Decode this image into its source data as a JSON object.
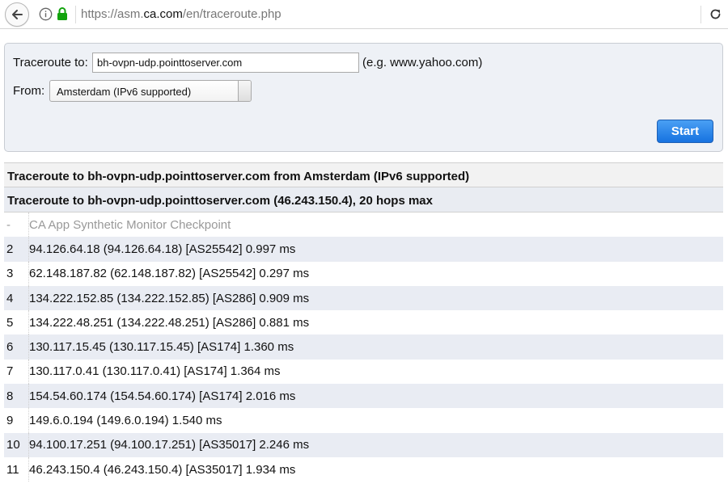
{
  "browser": {
    "url_prefix": "https://asm.",
    "url_domain": "ca.com",
    "url_path": "/en/traceroute.php"
  },
  "form": {
    "traceroute_label": "Traceroute to:",
    "target_value": "bh-ovpn-udp.pointtoserver.com",
    "example_text": "(e.g. www.yahoo.com)",
    "from_label": "From:",
    "from_selected": "Amsterdam (IPv6 supported)",
    "start_label": "Start",
    "accent_color": "#1672e0"
  },
  "results": {
    "header_1": "Traceroute to bh-ovpn-udp.pointtoserver.com from Amsterdam (IPv6 supported)",
    "header_2": "Traceroute to bh-ovpn-udp.pointtoserver.com (46.243.150.4), 20 hops max",
    "hops": [
      {
        "num": "-",
        "text": "CA App Synthetic Monitor Checkpoint",
        "muted": true
      },
      {
        "num": "2",
        "text": "94.126.64.18 (94.126.64.18) [AS25542] 0.997 ms"
      },
      {
        "num": "3",
        "text": "62.148.187.82 (62.148.187.82) [AS25542] 0.297 ms"
      },
      {
        "num": "4",
        "text": "134.222.152.85 (134.222.152.85) [AS286] 0.909 ms"
      },
      {
        "num": "5",
        "text": "134.222.48.251 (134.222.48.251) [AS286] 0.881 ms"
      },
      {
        "num": "6",
        "text": "130.117.15.45 (130.117.15.45) [AS174] 1.360 ms"
      },
      {
        "num": "7",
        "text": "130.117.0.41 (130.117.0.41) [AS174] 1.364 ms"
      },
      {
        "num": "8",
        "text": "154.54.60.174 (154.54.60.174) [AS174] 2.016 ms"
      },
      {
        "num": "9",
        "text": "149.6.0.194 (149.6.0.194) 1.540 ms"
      },
      {
        "num": "10",
        "text": "94.100.17.251 (94.100.17.251) [AS35017] 2.246 ms"
      },
      {
        "num": "11",
        "text": "46.243.150.4 (46.243.150.4) [AS35017] 1.934 ms"
      }
    ]
  }
}
